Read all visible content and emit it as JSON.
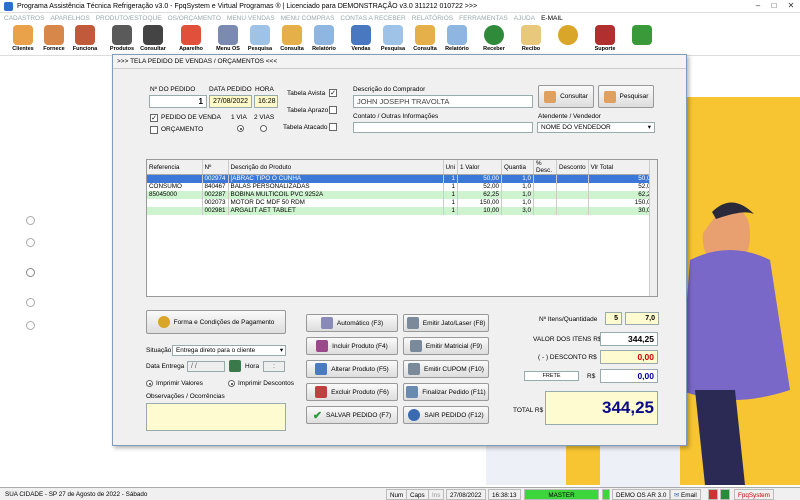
{
  "window": {
    "title": "Programa Assistência Técnica Refrigeração v3.0 - FpqSystem e Virtual Programas ® | Licenciado para  DEMONSTRAÇÃO v3.0 311212 010722 >>>"
  },
  "menu": [
    "CADASTROS",
    "APARELHOS",
    "PRODUTO/ESTOQUE",
    "OS/ORÇAMENTO",
    "MENU VENDAS",
    "MENU COMPRAS",
    "CONTAS A RECEBER",
    "RELATÓRIOS",
    "FERRAMENTAS",
    "AJUDA",
    "E-MAIL"
  ],
  "toolbar": [
    "Clientes",
    "Fornece",
    "Funciona",
    "Produtos",
    "Consultar",
    "Aparelho",
    "Menu OS",
    "Pesquisa",
    "Consulta",
    "Relatório",
    "Vendas",
    "Pesquisa",
    "Consulta",
    "Relatório",
    "Receber",
    "Recibo",
    "",
    "Suporte",
    ""
  ],
  "dialog": {
    "title": ">>>  TELA PEDIDO DE VENDAS / ORÇAMENTOS  <<<",
    "no_pedido_label": "Nº DO PEDIDO",
    "no_pedido": "1",
    "data_pedido_label": "DATA PEDIDO",
    "data_pedido": "27/08/2022",
    "hora_label": "HORA",
    "hora": "16:28",
    "tabela_avista": "Tabela Avista",
    "tabela_aprazo": "Tabela Aprazo",
    "tabela_atacado": "Tabela Atacado",
    "pedido_venda": "PEDIDO DE VENDA",
    "orcamento": "ORÇAMENTO",
    "via1": "1 VIA",
    "via2": "2 VIAS",
    "comprador_label": "Descrição do Comprador",
    "comprador": "JOHN JOSEPH TRAVOLTA",
    "contato_label": "Contato / Outras Informações",
    "contato": "",
    "consultar": "Consultar",
    "pesquisar": "Pesquisar",
    "atendente_label": "Atendente / Vendedor",
    "atendente": "NOME DO VENDEDOR"
  },
  "grid": {
    "headers": [
      "Referencia",
      "Nº",
      "Descrição do Produto",
      "Uni",
      "1 Valor",
      "Quantia",
      "% Desc.",
      "Desconto",
      "Vlr Total"
    ],
    "rows": [
      [
        "",
        "002974",
        "[ABRAC TIPO O CUNHA",
        "1",
        "50,00",
        "1,0",
        "",
        "",
        "50,00"
      ],
      [
        "CONSUMO",
        "840467",
        "BALAS PERSONALIZADAS",
        "1",
        "52,00",
        "1,0",
        "",
        "",
        "52,00"
      ],
      [
        "85045000",
        "002287",
        "BOBINA MULTICOIL PVC 9252A",
        "1",
        "62,25",
        "1,0",
        "",
        "",
        "62,25"
      ],
      [
        "",
        "002073",
        "MOTOR DC MDF 50 RDM",
        "1",
        "150,00",
        "1,0",
        "",
        "",
        "150,00"
      ],
      [
        "",
        "002981",
        "ARGALIT AET TABLET",
        "1",
        "10,00",
        "3,0",
        "",
        "",
        "30,00"
      ]
    ]
  },
  "bottom": {
    "forma_pagto": "Forma e Condições de Pagamento",
    "situacao_label": "Situação",
    "situacao": "Entrega direto para o cliente",
    "data_entrega_label": "Data Entrega",
    "data_entrega": " /  /",
    "hora_label": "Hora",
    "hora": ":",
    "imprimir_valores": "Imprimir Valores",
    "imprimir_descontos": "Imprimir Descontos",
    "obs_label": "Observações / Ocorrências",
    "obs": ""
  },
  "actions": {
    "automatico": "Automático     (F3)",
    "incluir": "Incluir Produto   (F4)",
    "alterar": "Alterar Produto   (F5)",
    "excluir": "Excluir Produto   (F6)",
    "salvar": "SALVAR PEDIDO (F7)",
    "emitir_jato": "Emitir Jato/Laser (F8)",
    "emitir_matricial": "Emitir Matricial    (F9)",
    "emitir_cupom": "Emitir CUPOM     (F10)",
    "finalizar": "Finalizar Pedido  (F11)",
    "sair": "SAIR  PEDIDO  (F12)"
  },
  "totals": {
    "itens_label": "Nº Itens/Quantidade",
    "itens": "5",
    "quantidade": "7,0",
    "valor_itens_label": "VALOR DOS ITENS R$",
    "valor_itens": "344,25",
    "desconto_label": "( - ) DESCONTO R$",
    "desconto": "0,00",
    "frete_label": "FRETE",
    "frete_rs": "R$",
    "frete": "0,00",
    "total_label": "TOTAL R$",
    "total": "344,25"
  },
  "status": {
    "cidade": "SUA CIDADE - SP 27 de Agosto de 2022 - Sábado",
    "num": "Num",
    "caps": "Caps",
    "ins": "Ins",
    "data": "27/08/2022",
    "hora": "16:38:13",
    "master": "MASTER",
    "demo": "DEMO OS AR 3.0",
    "email": "Email",
    "fpq": "FpqSystem"
  }
}
